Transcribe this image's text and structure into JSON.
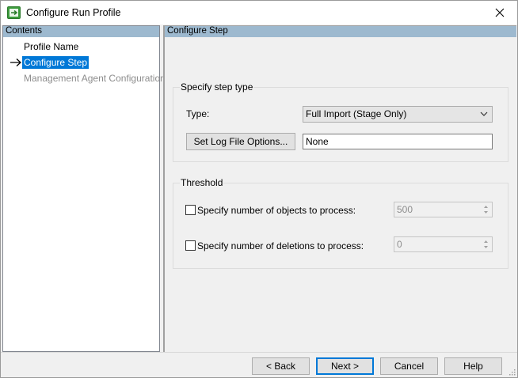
{
  "window": {
    "title": "Configure Run Profile"
  },
  "left_pane": {
    "header": "Contents",
    "items": [
      {
        "label": "Profile Name",
        "state": "normal"
      },
      {
        "label": "Configure Step",
        "state": "selected"
      },
      {
        "label": "Management Agent Configuration",
        "state": "disabled"
      }
    ]
  },
  "right_pane": {
    "header": "Configure Step",
    "step_type": {
      "group_label": "Specify step type",
      "type_label": "Type:",
      "type_value": "Full Import (Stage Only)",
      "log_button_label": "Set Log File Options...",
      "log_value": "None"
    },
    "threshold": {
      "group_label": "Threshold",
      "objects_label": "Specify number of objects to process:",
      "objects_value": "500",
      "deletions_label": "Specify number of deletions to process:",
      "deletions_value": "0"
    }
  },
  "footer": {
    "back_label": "< Back",
    "next_label": "Next >",
    "cancel_label": "Cancel",
    "help_label": "Help"
  },
  "colors": {
    "selection": "#0078d7",
    "pane_header": "#9db9cf",
    "icon_green": "#3c9b3c"
  }
}
